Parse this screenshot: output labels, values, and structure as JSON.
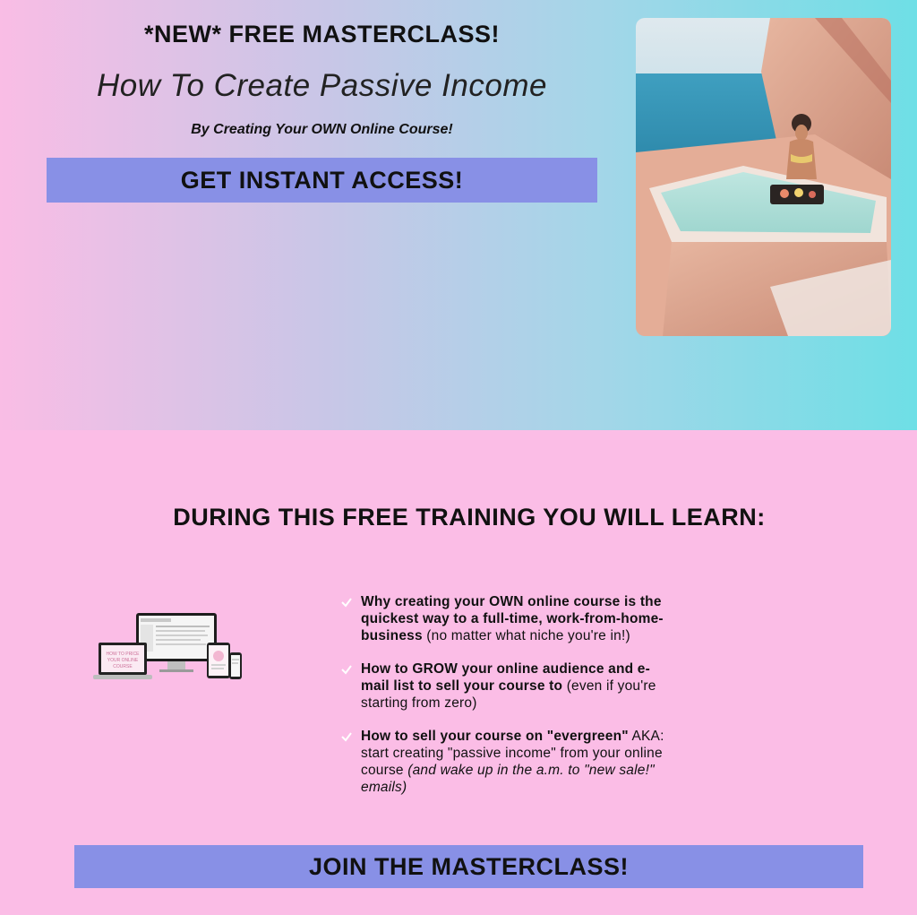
{
  "hero": {
    "kicker": "*NEW* FREE MASTERCLASS!",
    "headline": "How To Create Passive Income",
    "subline": "By Creating Your OWN Online Course!",
    "cta_label": "GET INSTANT ACCESS!",
    "image": "woman-in-plunge-pool-photo"
  },
  "training": {
    "title": "DURING THIS FREE TRAINING YOU WILL LEARN:",
    "devices_image": "course-devices-mockup",
    "items": [
      {
        "bold": "Why creating your OWN online course is the quickest way to a full-time, work-from-home-business",
        "plain": " (no matter what niche you're in!)",
        "italic": ""
      },
      {
        "bold": "How to GROW your online audience and e-mail list to sell your course to",
        "plain": " (even if you're starting from zero)",
        "italic": ""
      },
      {
        "bold": "How to sell your course on \"evergreen\"",
        "plain": " AKA: start creating \"passive income\" from your online course ",
        "italic": "(and wake up in the a.m. to \"new sale!\" emails)"
      }
    ],
    "check_icon": "check-icon"
  },
  "footer_cta": {
    "label": "JOIN THE MASTERCLASS!"
  },
  "colors": {
    "button": "#8890e6",
    "pink": "#fbbde6",
    "teal": "#6edfe6"
  }
}
